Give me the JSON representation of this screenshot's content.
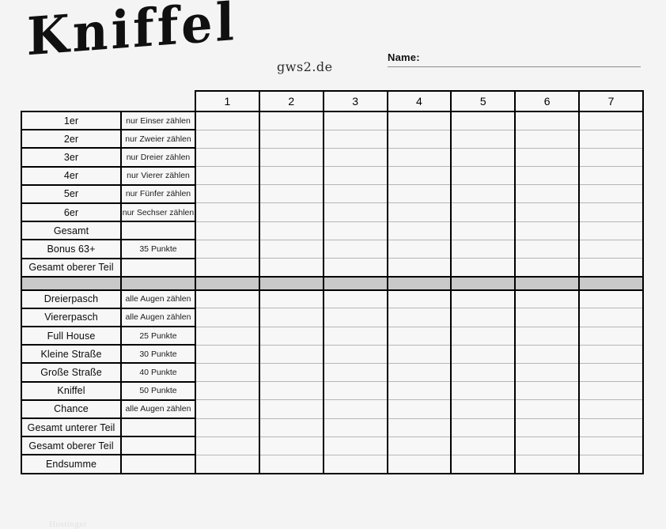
{
  "header": {
    "title": "Kniffel",
    "site_tag": "gws2.de",
    "name_label": "Name:",
    "name_value": ""
  },
  "table": {
    "player_columns": [
      "1",
      "2",
      "3",
      "4",
      "5",
      "6",
      "7"
    ],
    "upper_section": [
      {
        "label": "1er",
        "desc": "nur Einser zählen"
      },
      {
        "label": "2er",
        "desc": "nur Zweier zählen"
      },
      {
        "label": "3er",
        "desc": "nur Dreier zählen"
      },
      {
        "label": "4er",
        "desc": "nur Vierer zählen"
      },
      {
        "label": "5er",
        "desc": "nur Fünfer zählen"
      },
      {
        "label": "6er",
        "desc": "nur Sechser zählen"
      },
      {
        "label": "Gesamt",
        "desc": ""
      },
      {
        "label": "Bonus 63+",
        "desc": "35 Punkte"
      },
      {
        "label": "Gesamt oberer Teil",
        "desc": ""
      }
    ],
    "separator": {
      "label": "",
      "desc": ""
    },
    "lower_section": [
      {
        "label": "Dreierpasch",
        "desc": "alle Augen zählen"
      },
      {
        "label": "Viererpasch",
        "desc": "alle Augen zählen"
      },
      {
        "label": "Full House",
        "desc": "25 Punkte"
      },
      {
        "label": "Kleine Straße",
        "desc": "30 Punkte"
      },
      {
        "label": "Große Straße",
        "desc": "40 Punkte"
      },
      {
        "label": "Kniffel",
        "desc": "50 Punkte"
      },
      {
        "label": "Chance",
        "desc": "alle Augen zählen"
      },
      {
        "label": "Gesamt unterer Teil",
        "desc": ""
      },
      {
        "label": "Gesamt oberer Teil",
        "desc": ""
      },
      {
        "label": "Endsumme",
        "desc": ""
      }
    ]
  },
  "colors": {
    "page_background": "#f4f4f4",
    "cell_background": "#f7f7f7",
    "separator_gray": "#c9c9c9",
    "border_dark": "#000000",
    "grid_light": "#b6b6b6"
  }
}
